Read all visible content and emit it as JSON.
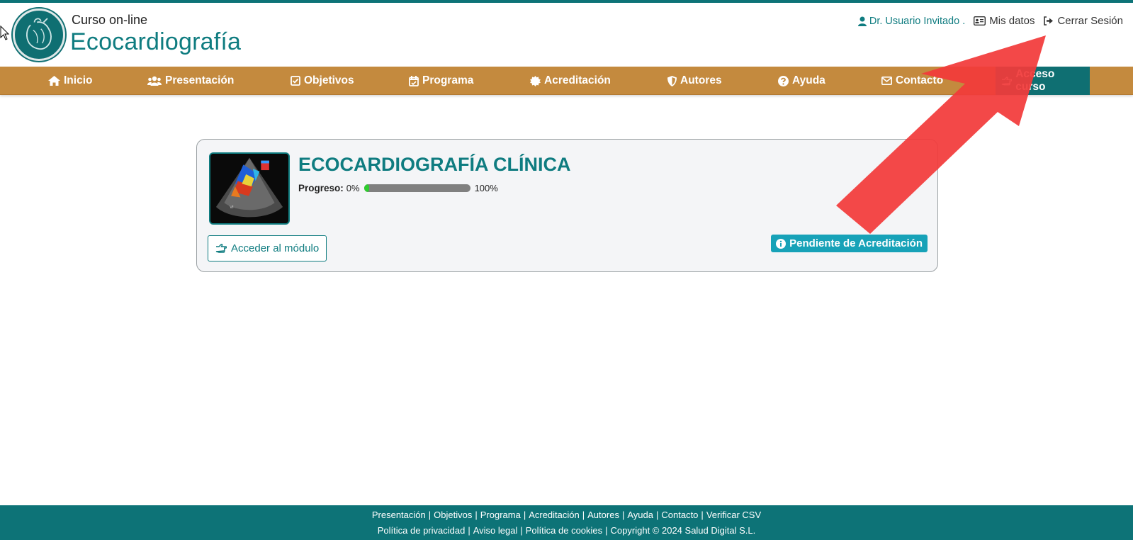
{
  "header": {
    "brand_top": "Curso  on-line",
    "brand_main": "Ecocardiografía",
    "user_name": "Dr. Usuario Invitado .",
    "my_data": "Mis datos",
    "logout": "Cerrar Sesión"
  },
  "nav": {
    "items": [
      {
        "label": "Inicio",
        "icon": "home-icon"
      },
      {
        "label": "Presentación",
        "icon": "users-icon"
      },
      {
        "label": "Objetivos",
        "icon": "check-square-icon"
      },
      {
        "label": "Programa",
        "icon": "calendar-check-icon"
      },
      {
        "label": "Acreditación",
        "icon": "certificate-icon"
      },
      {
        "label": "Autores",
        "icon": "shield-icon"
      },
      {
        "label": "Ayuda",
        "icon": "question-circle-icon"
      },
      {
        "label": "Contacto",
        "icon": "envelope-icon"
      },
      {
        "label": "Acceso curso",
        "icon": "hand-point-right-icon"
      }
    ]
  },
  "course": {
    "title": "ECOCARDIOGRAFÍA CLÍNICA",
    "progress_label": "Progreso:",
    "progress_min": "0%",
    "progress_max": "100%",
    "progress_value": 0.05,
    "access_button": "Acceder al módulo",
    "status_badge": "Pendiente de Acreditación"
  },
  "footer": {
    "row1": [
      "Presentación",
      "Objetivos",
      "Programa",
      "Acreditación",
      "Autores",
      "Ayuda",
      "Contacto",
      "Verificar CSV"
    ],
    "row2": [
      "Política de privacidad",
      "Aviso legal",
      "Política de cookies",
      "Copyright © 2024 Salud Digital S.L."
    ]
  },
  "colors": {
    "teal": "#0f7c80",
    "nav_bg": "#c48a3e",
    "active_nav": "#0f6f72",
    "badge": "#17a2b8",
    "progress_fill": "#2ecc2e",
    "annotation_arrow": "#f23a3a"
  }
}
